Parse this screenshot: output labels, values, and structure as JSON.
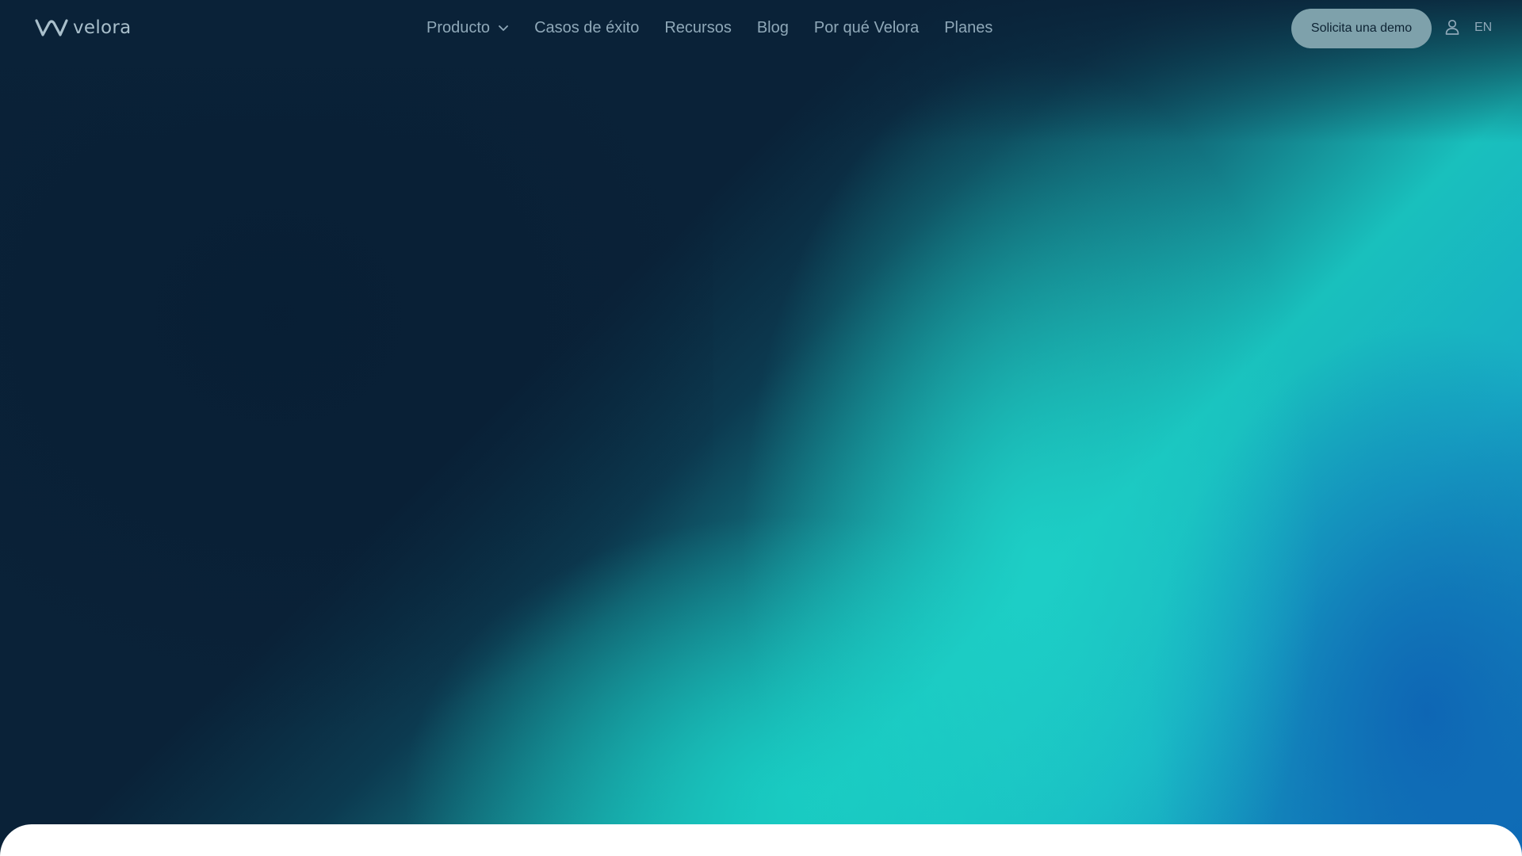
{
  "brand": {
    "name": "velora",
    "logo_icon": "velora-wave-icon"
  },
  "nav": {
    "items": [
      {
        "label": "Producto",
        "has_dropdown": true
      },
      {
        "label": "Casos de éxito"
      },
      {
        "label": "Recursos"
      },
      {
        "label": "Blog"
      },
      {
        "label": "Por qué Velora"
      },
      {
        "label": "Planes"
      }
    ],
    "demo_button": "Solicita una demo",
    "account_icon": "user-icon",
    "language": "EN"
  },
  "colors": {
    "background_dark": "#0a2238",
    "accent_teal": "#19c4bf",
    "accent_blue": "#0f6fb6",
    "button_bg": "#7ea1ab",
    "nav_text": "#8fa8b8"
  }
}
